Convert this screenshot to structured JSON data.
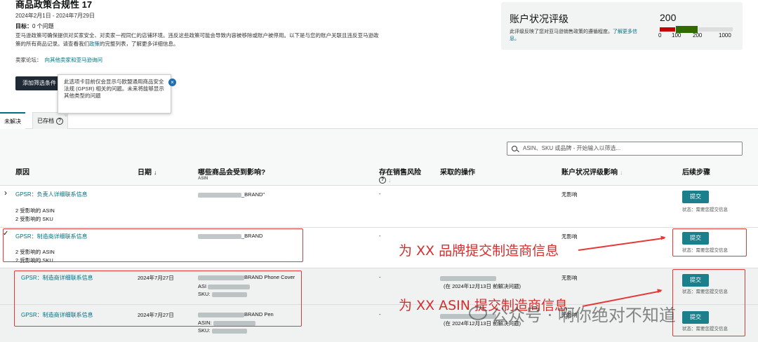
{
  "header": {
    "title": "商品政策合规性 17",
    "date_range": "2024年2月1日 - 2024年7月29日",
    "target_label": "目标：",
    "target_value": "0 个问题",
    "description_prefix": "亚马逊政策可确保提供对买家安全、对卖家一视同仁的店铺环境。违反这些政策可能会导致内容被移除或账户被停用。以下是与您的账户关联且违反亚马逊政策的所有商品记录。请查看我们",
    "description_link": "政策",
    "description_suffix": "的完整列表，了解更多详细信息。",
    "forum_label": "卖家论坛：",
    "forum_link": "向其他卖家和亚马逊询问",
    "add_filter_label": "添加筛选条件",
    "tooltip_text": "此选项卡目前仅会显示与欧盟通用商品安全法规 (GPSR) 相关的问题。未来将能够显示其他类型的问题"
  },
  "health": {
    "title": "账户状况评级",
    "desc": "此评级反映了您对亚马逊销售政策的遵循程度。",
    "link": "了解更多信息。",
    "score": "200",
    "ticks": [
      "0",
      "100",
      "200",
      "1000"
    ],
    "colors": {
      "red": "#c40000",
      "green": "#6a9a1f",
      "dark_green": "#2f6b00",
      "gray": "#dddddd"
    }
  },
  "tabs": [
    {
      "label": "未解决"
    },
    {
      "label": "已存档"
    }
  ],
  "search": {
    "placeholder": "ASIN、SKU 或品牌 - 开始输入以筛选..."
  },
  "columns": {
    "reason": "原因",
    "date": "日期",
    "affected": "哪些商品会受到影响?",
    "affected_sub": "ASIN",
    "risk": "存在销售风险",
    "action": "采取的操作",
    "health_impact": "账户状况评级影响",
    "next_steps": "后续步骤"
  },
  "rows": [
    {
      "reason": "GPSR：负责人详细联系信息",
      "date": "",
      "product_suffix": "_BRAND\"",
      "asins": "2 受影响的 ASIN",
      "skus": "2 受影响的 SKU",
      "risk": "-",
      "action": "",
      "impact": "无影响",
      "button": "提交",
      "status": "状态：需要您提交信息"
    },
    {
      "reason": "GPSR：制造商详细联系信息",
      "date": "",
      "product_suffix": "_BRAND",
      "asins": "2 受影响的 ASIN",
      "skus": "2 受影响的 SKU",
      "risk": "-",
      "action": "",
      "impact": "无影响",
      "button": "提交",
      "status": "状态：需要您提交信息"
    },
    {
      "reason": "GPSR：制造商详细联系信息",
      "date": "2024年7月27日",
      "product_suffix": "BRAND Phone Cover",
      "asin_label": "ASI",
      "sku_label": "SKU:",
      "risk": "-",
      "action": "(在 2024年12月13日 前解决问题)",
      "impact": "无影响",
      "button": "提交",
      "status": "状态：需要您提交信息"
    },
    {
      "reason": "GPSR：制造商详细联系信息",
      "date": "2024年7月27日",
      "product_suffix": "BRAND Pen",
      "asin_label": "ASIN:",
      "sku_label": "SKU:",
      "risk": "-",
      "action": "(在 2024年12月13日 前解决问题)",
      "impact": "无影响",
      "button": "提交",
      "status": "状态：需要您提交信息"
    }
  ],
  "annotations": {
    "brand": "为 XX 品牌提交制造商信息",
    "asin": "为 XX ASIN 提交制造商信息"
  },
  "watermark": "公众号 · 啊你绝对不知道"
}
